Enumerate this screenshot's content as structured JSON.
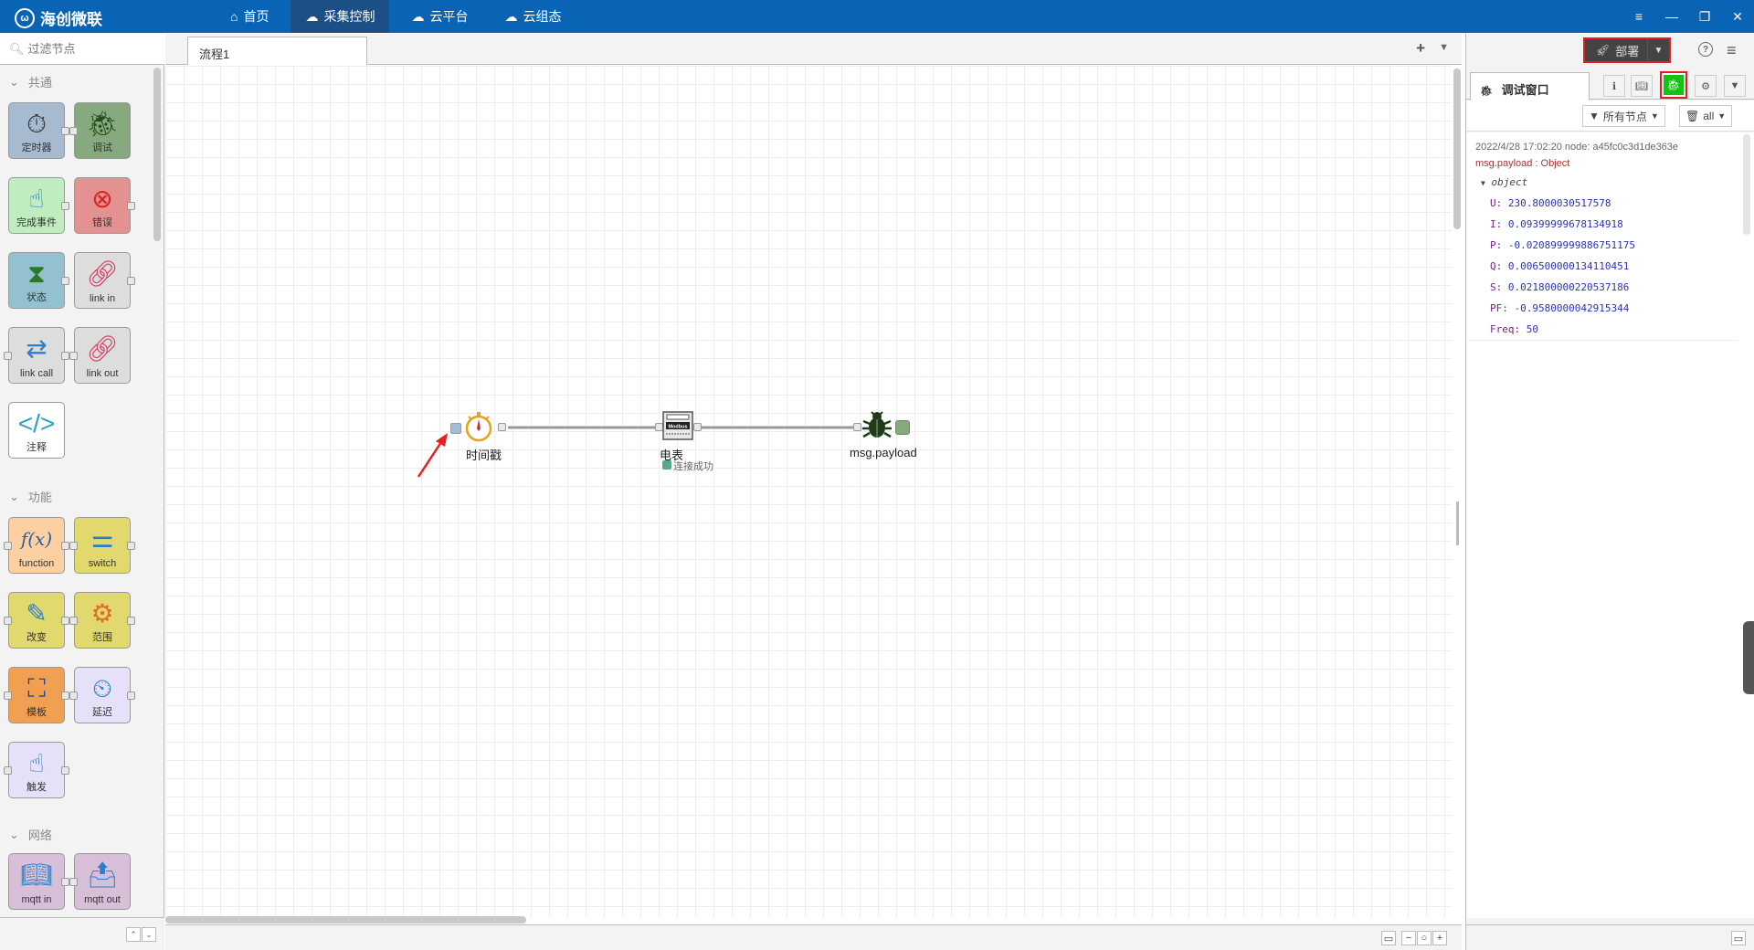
{
  "app": {
    "brand": "海创微联"
  },
  "nav": [
    {
      "label": "首页",
      "icon": "home-icon"
    },
    {
      "label": "采集控制",
      "icon": "cloud-gear-icon",
      "active": true
    },
    {
      "label": "云平台",
      "icon": "cloud-platform-icon"
    },
    {
      "label": "云组态",
      "icon": "cloud-config-icon"
    }
  ],
  "palette": {
    "search_placeholder": "过滤节点",
    "categories": [
      {
        "label": "共通"
      },
      {
        "label": "功能"
      },
      {
        "label": "网络"
      }
    ],
    "nodes": [
      {
        "label": "定时器",
        "icon": "stopwatch-icon"
      },
      {
        "label": "调试",
        "icon": "bug-icon"
      },
      {
        "label": "完成事件",
        "icon": "touch-icon"
      },
      {
        "label": "错误",
        "icon": "error-icon"
      },
      {
        "label": "状态",
        "icon": "hourglass-icon"
      },
      {
        "label": "link in",
        "icon": "link-in-icon"
      },
      {
        "label": "link call",
        "icon": "link-call-icon"
      },
      {
        "label": "link out",
        "icon": "link-out-icon"
      },
      {
        "label": "注释",
        "icon": "comment-icon"
      },
      {
        "label": "function",
        "icon": "function-icon"
      },
      {
        "label": "switch",
        "icon": "switch-icon"
      },
      {
        "label": "改变",
        "icon": "change-icon"
      },
      {
        "label": "范围",
        "icon": "range-icon"
      },
      {
        "label": "模板",
        "icon": "template-icon"
      },
      {
        "label": "延迟",
        "icon": "delay-icon"
      },
      {
        "label": "触发",
        "icon": "trigger-icon"
      },
      {
        "label": "mqtt in",
        "icon": "mqtt-in-icon"
      },
      {
        "label": "mqtt out",
        "icon": "mqtt-out-icon"
      }
    ]
  },
  "workspace": {
    "tab": "流程1",
    "flow": {
      "inject_label": "时间戳",
      "modbus_label": "电表",
      "modbus_status": "连接成功",
      "debug_label": "msg.payload"
    }
  },
  "sidebar": {
    "deploy_label": "部署",
    "debug_tab": "调试窗口",
    "filter_nodes": "所有节点",
    "clear_filter": "all",
    "messages": [
      {
        "meta": "2022/4/28 17:02:20   node: a45fc0c3d1de363e",
        "topic": "msg.payload : Object",
        "object_label": "object",
        "props": [
          {
            "k": "U:",
            "v": "230.8000030517578"
          },
          {
            "k": "I:",
            "v": "0.09399999678134918"
          },
          {
            "k": "P:",
            "v": "-0.020899999886751175"
          },
          {
            "k": "Q:",
            "v": "0.006500000134110451"
          },
          {
            "k": "S:",
            "v": "0.021800000220537186"
          },
          {
            "k": "PF:",
            "v": "-0.9580000042915344"
          },
          {
            "k": "Freq:",
            "v": "50"
          }
        ]
      }
    ]
  },
  "colors": {
    "topbar": "#0a64b6",
    "nav_active": "#1c4f86",
    "highlight_border": "#e02020",
    "debug_active": "#14c214",
    "status_ok": "#5a8"
  }
}
